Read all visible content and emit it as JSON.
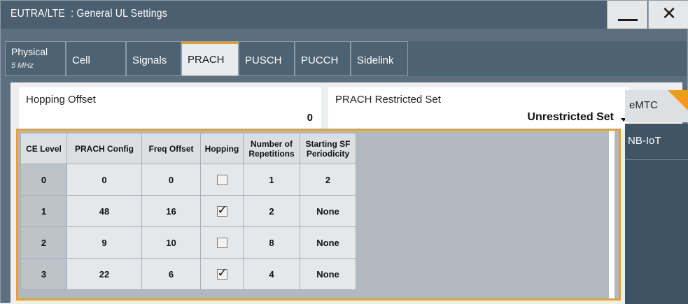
{
  "window": {
    "title": "EUTRA/LTE  : General UL Settings",
    "minimize_label": "—",
    "close_label": "✕"
  },
  "tabs": [
    {
      "label": "Physical",
      "sub": "5 MHz"
    },
    {
      "label": "Cell"
    },
    {
      "label": "Signals"
    },
    {
      "label": "PRACH",
      "active": true
    },
    {
      "label": "PUSCH"
    },
    {
      "label": "PUCCH"
    },
    {
      "label": "Sidelink"
    }
  ],
  "fields": {
    "hopping_offset": {
      "label": "Hopping Offset",
      "value": "0"
    },
    "prach_restricted_set": {
      "label": "PRACH Restricted Set",
      "value": "Unrestricted Set"
    }
  },
  "side_tabs": {
    "emtc": "eMTC",
    "nbiot": "NB-IoT"
  },
  "table": {
    "headers": [
      "CE Level",
      "PRACH Config",
      "Freq Offset",
      "Hopping",
      "Number of Repetitions",
      "Starting SF Periodicity"
    ],
    "header_lines": [
      [
        "CE Level"
      ],
      [
        "PRACH Config"
      ],
      [
        "Freq Offset"
      ],
      [
        "Hopping"
      ],
      [
        "Number of",
        "Repetitions"
      ],
      [
        "Starting SF",
        "Periodicity"
      ]
    ],
    "rows": [
      {
        "ce_level": "0",
        "prach_config": "0",
        "freq_offset": "0",
        "hopping": false,
        "repetitions": "1",
        "periodicity": "2"
      },
      {
        "ce_level": "1",
        "prach_config": "48",
        "freq_offset": "16",
        "hopping": true,
        "repetitions": "2",
        "periodicity": "None"
      },
      {
        "ce_level": "2",
        "prach_config": "9",
        "freq_offset": "10",
        "hopping": false,
        "repetitions": "8",
        "periodicity": "None"
      },
      {
        "ce_level": "3",
        "prach_config": "22",
        "freq_offset": "6",
        "hopping": true,
        "repetitions": "4",
        "periodicity": "None"
      }
    ]
  },
  "colors": {
    "accent": "#f29a1f",
    "titlebar": "#4b5f70",
    "tab_bg": "#4d6272"
  }
}
